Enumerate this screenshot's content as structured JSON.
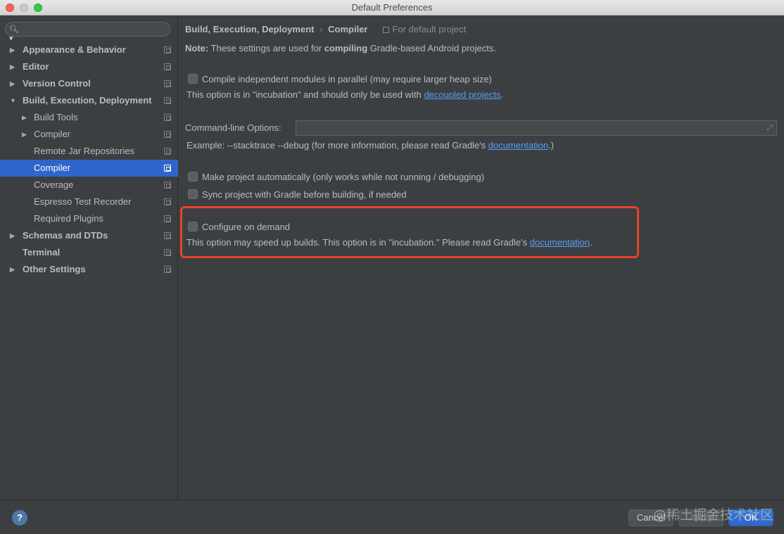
{
  "window": {
    "title": "Default Preferences"
  },
  "sidebar": {
    "items": [
      {
        "label": "Appearance & Behavior",
        "arrow": "▶"
      },
      {
        "label": "Editor",
        "arrow": "▶"
      },
      {
        "label": "Version Control",
        "arrow": "▶"
      },
      {
        "label": "Build, Execution, Deployment",
        "arrow": "▼"
      },
      {
        "label": "Build Tools",
        "arrow": "▶"
      },
      {
        "label": "Compiler",
        "arrow": "▶"
      },
      {
        "label": "Remote Jar Repositories",
        "arrow": ""
      },
      {
        "label": "Compiler",
        "arrow": ""
      },
      {
        "label": "Coverage",
        "arrow": ""
      },
      {
        "label": "Espresso Test Recorder",
        "arrow": ""
      },
      {
        "label": "Required Plugins",
        "arrow": ""
      },
      {
        "label": "Schemas and DTDs",
        "arrow": "▶"
      },
      {
        "label": "Terminal",
        "arrow": ""
      },
      {
        "label": "Other Settings",
        "arrow": "▶"
      }
    ]
  },
  "main": {
    "breadcrumb": {
      "parent": "Build, Execution, Deployment",
      "separator": "›",
      "current": "Compiler",
      "scope": "For default project"
    },
    "note": {
      "prefix": "Note:",
      "text_1": " These settings are used for ",
      "bold": "compiling",
      "text_2": " Gradle-based Android projects."
    },
    "parallel": {
      "label": "Compile independent modules in parallel (may require larger heap size)",
      "hint": "This option is in \"incubation\" and should only be used with ",
      "link": "decoupled projects",
      "hint_end": "."
    },
    "cmdline": {
      "label": "Command-line Options:",
      "value": "",
      "example": "Example: --stacktrace --debug (for more information, please read Gradle's ",
      "link": "documentation",
      "example_end": ".)"
    },
    "make_auto": {
      "label": "Make project automatically (only works while not running / debugging)"
    },
    "sync": {
      "label": "Sync project with Gradle before building, if needed"
    },
    "configure": {
      "label": "Configure on demand",
      "hint": "This option may speed up builds. This option is in \"incubation.\" Please read Gradle's ",
      "link": "documentation",
      "hint_end": "."
    }
  },
  "footer": {
    "help": "?",
    "cancel": "Cancel",
    "apply": "Apply",
    "ok": "OK",
    "watermark": "@稀土掘金技术社区"
  },
  "colors": {
    "accent": "#2f65ca",
    "link": "#589df6",
    "highlight_box": "#e8412b"
  }
}
